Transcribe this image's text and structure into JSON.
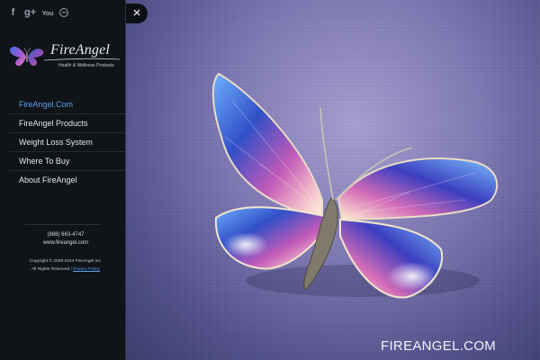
{
  "social": {
    "facebook": "f",
    "googleplus": "g+",
    "youtube": "You"
  },
  "logo": {
    "name": "FireAngel",
    "tagline": "Health & Wellness Products"
  },
  "nav": [
    {
      "label": "FireAngel.Com",
      "active": true
    },
    {
      "label": "FireAngel Products",
      "active": false
    },
    {
      "label": "Weight Loss System",
      "active": false
    },
    {
      "label": "Where To Buy",
      "active": false
    },
    {
      "label": "About FireAngel",
      "active": false
    }
  ],
  "contact": {
    "phone": "(888) 663-4747",
    "website": "www.fireangel.com"
  },
  "footer": {
    "copyright": "Copyright © 2009-2014 FireAngel Inc.",
    "rights": "All Rights Reserved",
    "separator": "|",
    "privacy": "Privacy Policy"
  },
  "hero": {
    "brand_text": "FIREANGEL.COM"
  },
  "colors": {
    "link_blue": "#5aa2ee",
    "sidebar_bg": "#101318"
  }
}
